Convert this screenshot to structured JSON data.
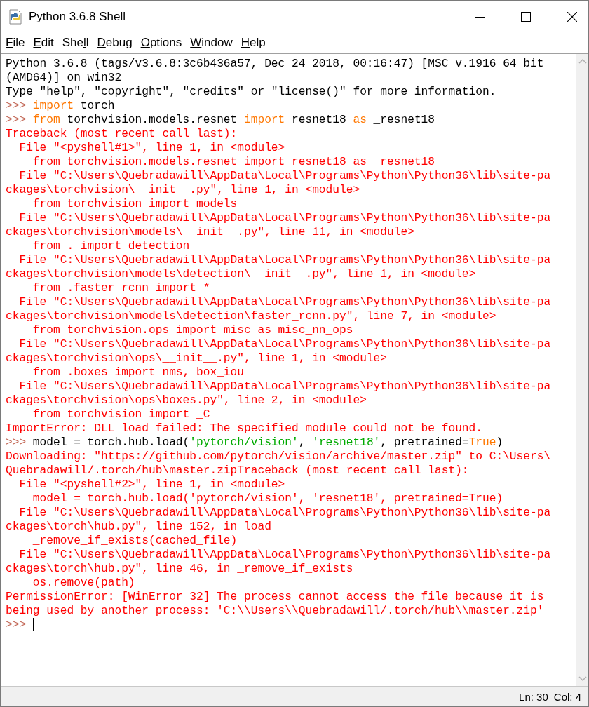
{
  "window": {
    "title": "Python 3.6.8 Shell"
  },
  "menu": [
    {
      "key": "F",
      "after": "ile"
    },
    {
      "key": "E",
      "after": "dit"
    },
    {
      "before": "She",
      "key": "l",
      "after": "l"
    },
    {
      "key": "D",
      "after": "ebug"
    },
    {
      "key": "O",
      "after": "ptions"
    },
    {
      "key": "W",
      "after": "indow"
    },
    {
      "key": "H",
      "after": "elp"
    }
  ],
  "shell": {
    "lines": [
      [
        {
          "kind": "stdout",
          "text": "Python 3.6.8 (tags/v3.6.8:3c6b436a57, Dec 24 2018, 00:16:47) [MSC v.1916 64 bit"
        }
      ],
      [
        {
          "kind": "stdout",
          "text": "(AMD64)] on win32"
        }
      ],
      [
        {
          "kind": "stdout",
          "text": "Type \"help\", \"copyright\", \"credits\" or \"license()\" for more information."
        }
      ],
      [
        {
          "kind": "prompt",
          "text": ">>> "
        },
        {
          "kind": "keyword",
          "text": "import"
        },
        {
          "kind": "code",
          "text": " torch"
        }
      ],
      [
        {
          "kind": "prompt",
          "text": ">>> "
        },
        {
          "kind": "keyword",
          "text": "from"
        },
        {
          "kind": "code",
          "text": " torchvision.models.resnet "
        },
        {
          "kind": "keyword",
          "text": "import"
        },
        {
          "kind": "code",
          "text": " resnet18 "
        },
        {
          "kind": "keyword",
          "text": "as"
        },
        {
          "kind": "code",
          "text": " _resnet18"
        }
      ],
      [
        {
          "kind": "error",
          "text": "Traceback (most recent call last):"
        }
      ],
      [
        {
          "kind": "error",
          "text": "  File \"<pyshell#1>\", line 1, in <module>"
        }
      ],
      [
        {
          "kind": "error",
          "text": "    from torchvision.models.resnet import resnet18 as _resnet18"
        }
      ],
      [
        {
          "kind": "error",
          "text": "  File \"C:\\Users\\Quebradawill\\AppData\\Local\\Programs\\Python\\Python36\\lib\\site-pa"
        }
      ],
      [
        {
          "kind": "error",
          "text": "ckages\\torchvision\\__init__.py\", line 1, in <module>"
        }
      ],
      [
        {
          "kind": "error",
          "text": "    from torchvision import models"
        }
      ],
      [
        {
          "kind": "error",
          "text": "  File \"C:\\Users\\Quebradawill\\AppData\\Local\\Programs\\Python\\Python36\\lib\\site-pa"
        }
      ],
      [
        {
          "kind": "error",
          "text": "ckages\\torchvision\\models\\__init__.py\", line 11, in <module>"
        }
      ],
      [
        {
          "kind": "error",
          "text": "    from . import detection"
        }
      ],
      [
        {
          "kind": "error",
          "text": "  File \"C:\\Users\\Quebradawill\\AppData\\Local\\Programs\\Python\\Python36\\lib\\site-pa"
        }
      ],
      [
        {
          "kind": "error",
          "text": "ckages\\torchvision\\models\\detection\\__init__.py\", line 1, in <module>"
        }
      ],
      [
        {
          "kind": "error",
          "text": "    from .faster_rcnn import *"
        }
      ],
      [
        {
          "kind": "error",
          "text": "  File \"C:\\Users\\Quebradawill\\AppData\\Local\\Programs\\Python\\Python36\\lib\\site-pa"
        }
      ],
      [
        {
          "kind": "error",
          "text": "ckages\\torchvision\\models\\detection\\faster_rcnn.py\", line 7, in <module>"
        }
      ],
      [
        {
          "kind": "error",
          "text": "    from torchvision.ops import misc as misc_nn_ops"
        }
      ],
      [
        {
          "kind": "error",
          "text": "  File \"C:\\Users\\Quebradawill\\AppData\\Local\\Programs\\Python\\Python36\\lib\\site-pa"
        }
      ],
      [
        {
          "kind": "error",
          "text": "ckages\\torchvision\\ops\\__init__.py\", line 1, in <module>"
        }
      ],
      [
        {
          "kind": "error",
          "text": "    from .boxes import nms, box_iou"
        }
      ],
      [
        {
          "kind": "error",
          "text": "  File \"C:\\Users\\Quebradawill\\AppData\\Local\\Programs\\Python\\Python36\\lib\\site-pa"
        }
      ],
      [
        {
          "kind": "error",
          "text": "ckages\\torchvision\\ops\\boxes.py\", line 2, in <module>"
        }
      ],
      [
        {
          "kind": "error",
          "text": "    from torchvision import _C"
        }
      ],
      [
        {
          "kind": "error",
          "text": "ImportError: DLL load failed: The specified module could not be found."
        }
      ],
      [
        {
          "kind": "prompt",
          "text": ">>> "
        },
        {
          "kind": "code",
          "text": "model = torch.hub.load("
        },
        {
          "kind": "string",
          "text": "'pytorch/vision'"
        },
        {
          "kind": "code",
          "text": ", "
        },
        {
          "kind": "string",
          "text": "'resnet18'"
        },
        {
          "kind": "code",
          "text": ", pretrained="
        },
        {
          "kind": "keyword",
          "text": "True"
        },
        {
          "kind": "code",
          "text": ")"
        }
      ],
      [
        {
          "kind": "error",
          "text": "Downloading: \"https://github.com/pytorch/vision/archive/master.zip\" to C:\\Users\\"
        }
      ],
      [
        {
          "kind": "error",
          "text": "Quebradawill/.torch/hub\\master.zipTraceback (most recent call last):"
        }
      ],
      [
        {
          "kind": "error",
          "text": "  File \"<pyshell#2>\", line 1, in <module>"
        }
      ],
      [
        {
          "kind": "error",
          "text": "    model = torch.hub.load('pytorch/vision', 'resnet18', pretrained=True)"
        }
      ],
      [
        {
          "kind": "error",
          "text": "  File \"C:\\Users\\Quebradawill\\AppData\\Local\\Programs\\Python\\Python36\\lib\\site-pa"
        }
      ],
      [
        {
          "kind": "error",
          "text": "ckages\\torch\\hub.py\", line 152, in load"
        }
      ],
      [
        {
          "kind": "error",
          "text": "    _remove_if_exists(cached_file)"
        }
      ],
      [
        {
          "kind": "error",
          "text": "  File \"C:\\Users\\Quebradawill\\AppData\\Local\\Programs\\Python\\Python36\\lib\\site-pa"
        }
      ],
      [
        {
          "kind": "error",
          "text": "ckages\\torch\\hub.py\", line 46, in _remove_if_exists"
        }
      ],
      [
        {
          "kind": "error",
          "text": "    os.remove(path)"
        }
      ],
      [
        {
          "kind": "error",
          "text": "PermissionError: [WinError 32] The process cannot access the file because it is"
        }
      ],
      [
        {
          "kind": "error",
          "text": "being used by another process: 'C:\\\\Users\\\\Quebradawill/.torch/hub\\\\master.zip'"
        }
      ],
      [
        {
          "kind": "prompt",
          "text": ">>> "
        }
      ]
    ]
  },
  "status_bar": {
    "line": "Ln: 30",
    "column": "Col: 4"
  }
}
